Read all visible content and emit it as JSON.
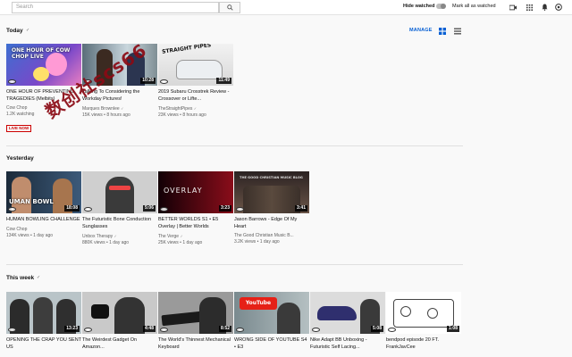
{
  "topbar": {
    "search_placeholder": "Search",
    "hide_watched_label": "Hide watched",
    "mark_all_label": "Mark all as watched",
    "icons": [
      "video-camera-icon",
      "apps-grid-icon",
      "notifications-bell-icon",
      "chat-icon",
      "avatar"
    ]
  },
  "view": {
    "manage_label": "MANAGE",
    "active_view": "grid",
    "accent_color": "#065fd4"
  },
  "sections": [
    {
      "title": "Today",
      "videos": [
        {
          "title": "ONE HOUR OF PREVENTING TRAGEDIES (Melbits)",
          "channel": "Cow Chop",
          "meta": "1.2K watching",
          "duration": "",
          "badge": "LIVE NOW"
        },
        {
          "title": "Talking To Considering the Workday Pictures!",
          "channel": "Marques Brownlee",
          "meta": "15K views • 8 hours ago",
          "duration": "10:28",
          "badge": ""
        },
        {
          "title": "2019 Subaru Crosstrek Review - Crossover or Lifte...",
          "channel": "TheStraightPipes",
          "meta": "23K views • 8 hours ago",
          "duration": "11:49",
          "badge": ""
        }
      ]
    },
    {
      "title": "Yesterday",
      "videos": [
        {
          "title": "HUMAN BOWLING CHALLENGE",
          "channel": "Cow Chop",
          "meta": "134K views • 1 day ago",
          "duration": "18:08",
          "badge": ""
        },
        {
          "title": "The Futuristic Bone Conduction Sunglasses",
          "channel": "Unbox Therapy",
          "meta": "880K views • 1 day ago",
          "duration": "5:06",
          "badge": ""
        },
        {
          "title": "BETTER WORLDS  S1 • E5 Overlay | Better Worlds",
          "channel": "The Verge",
          "meta": "25K views • 1 day ago",
          "duration": "3:23",
          "badge": ""
        },
        {
          "title": "Jason Barrows - Edge Of My Heart",
          "channel": "The Good Christian Music B...",
          "meta": "3.2K views • 1 day ago",
          "duration": "3:41",
          "badge": ""
        }
      ]
    },
    {
      "title": "This week",
      "videos": [
        {
          "title": "OPENING THE CRAP YOU SENT US",
          "channel": "",
          "meta": "",
          "duration": "13:23",
          "badge": ""
        },
        {
          "title": "The Weirdest Gadget On Amazon...",
          "channel": "",
          "meta": "",
          "duration": "4:48",
          "badge": ""
        },
        {
          "title": "The World's Thinnest Mechanical Keyboard",
          "channel": "",
          "meta": "",
          "duration": "8:52",
          "badge": ""
        },
        {
          "title": "WRONG SIDE OF YOUTUBE  S4 • E3",
          "channel": "",
          "meta": "",
          "duration": "",
          "badge": ""
        },
        {
          "title": "Nike Adapt BB Unboxing - Futuristic Self Lacing...",
          "channel": "",
          "meta": "",
          "duration": "5:08",
          "badge": ""
        },
        {
          "title": "bendpod episode 20 FT. FrankJavCee",
          "channel": "",
          "meta": "",
          "duration": "1:08",
          "badge": ""
        }
      ]
    }
  ],
  "thumb_texts": {
    "cow_live": "ONE HOUR OF COW CHOP LIVE",
    "bowl": "UMAN BOWL",
    "overlay": "OVERLAY",
    "music": "THE GOOD CHRISTIAN MUSIC BLOG",
    "youtube": "YouTube",
    "straight_pipes": "STRAIGHT PIPES"
  },
  "watermark": "数创社scs66"
}
